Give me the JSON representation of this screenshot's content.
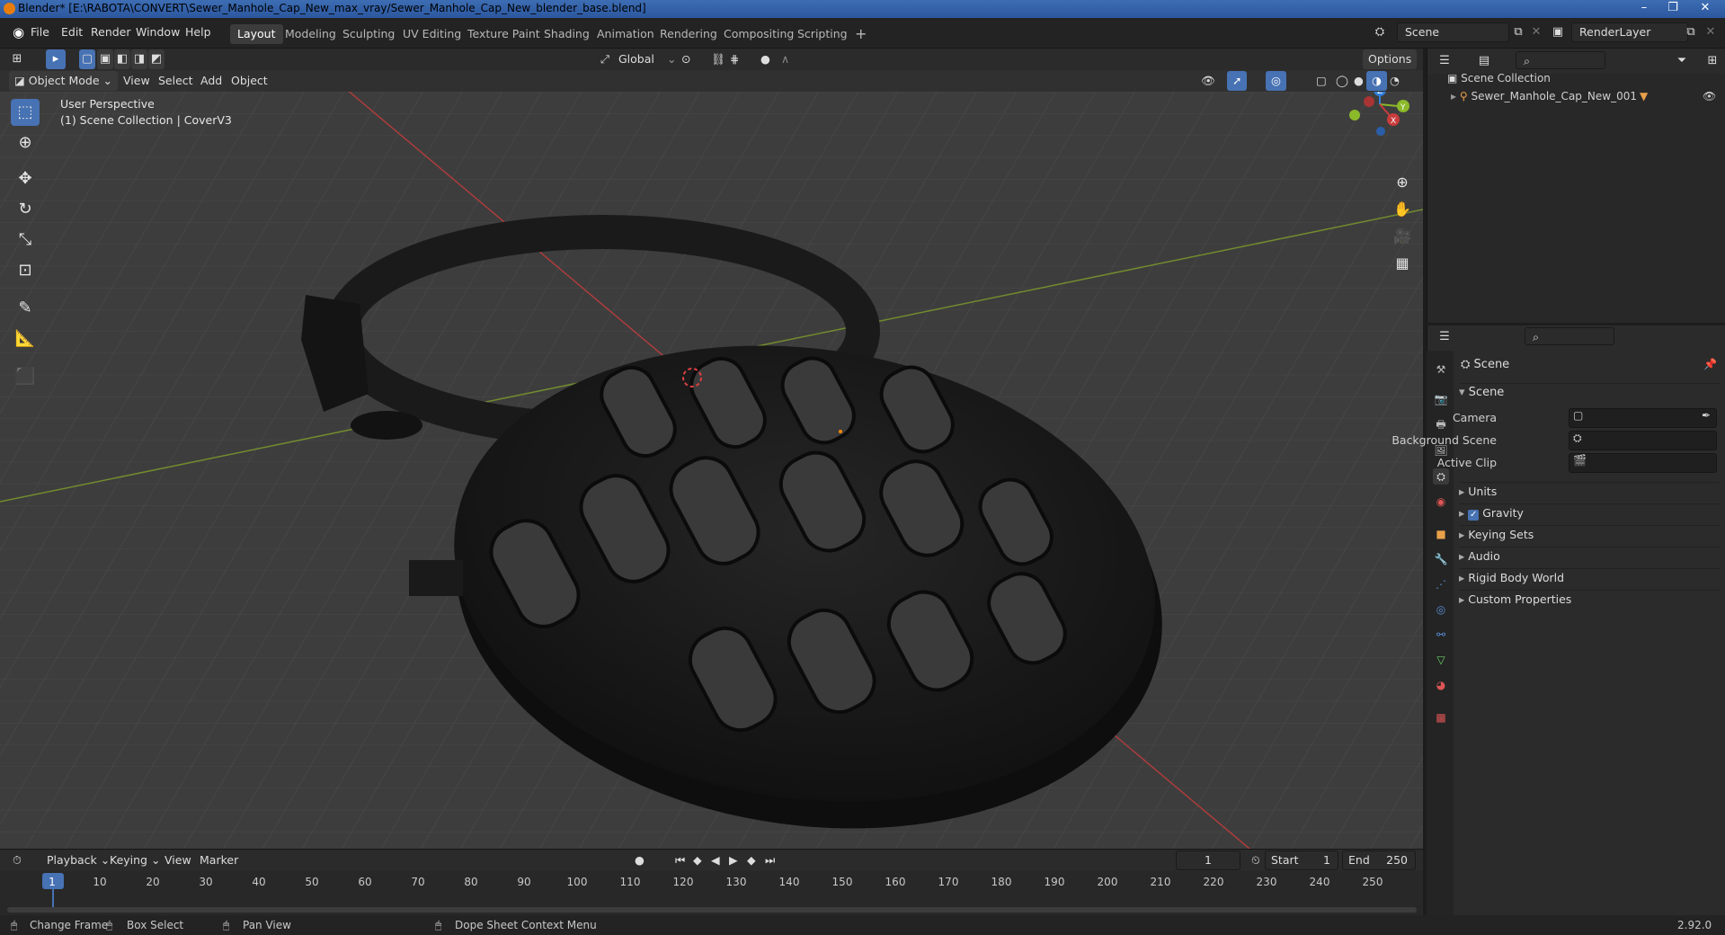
{
  "window": {
    "title": "Blender* [E:\\RABOTA\\CONVERT\\Sewer_Manhole_Cap_New_max_vray/Sewer_Manhole_Cap_New_blender_base.blend]",
    "controls": [
      "–",
      "❐",
      "✕"
    ]
  },
  "menu": [
    "File",
    "Edit",
    "Render",
    "Window",
    "Help"
  ],
  "workspaces": [
    "Layout",
    "Modeling",
    "Sculpting",
    "UV Editing",
    "Texture Paint",
    "Shading",
    "Animation",
    "Rendering",
    "Compositing",
    "Scripting"
  ],
  "active_workspace": "Layout",
  "scene_selector": "Scene",
  "render_layer": "RenderLayer",
  "viewport_header": {
    "mode": "Object Mode",
    "menus": [
      "View",
      "Select",
      "Add",
      "Object"
    ],
    "transform_orientation": "Global",
    "options": "Options"
  },
  "viewport": {
    "perspective": "User Perspective",
    "collection_info": "(1) Scene Collection | CoverV3",
    "gizmo_axes": [
      "Z",
      "Y",
      "X"
    ],
    "tools": [
      "select-box-icon",
      "cursor-icon",
      "move-icon",
      "rotate-icon",
      "scale-icon",
      "transform-icon",
      "annotate-icon",
      "measure-icon",
      "add-cube-icon"
    ]
  },
  "outliner": {
    "root": "Scene Collection",
    "items": [
      {
        "label": "Sewer_Manhole_Cap_New_001"
      }
    ]
  },
  "properties": {
    "context": "Scene",
    "section": "Scene",
    "fields": [
      {
        "label": "Camera",
        "value": ""
      },
      {
        "label": "Background Scene",
        "value": ""
      },
      {
        "label": "Active Clip",
        "value": ""
      }
    ],
    "panels": [
      "Units",
      "Gravity",
      "Keying Sets",
      "Audio",
      "Rigid Body World",
      "Custom Properties"
    ],
    "gravity_checked": true
  },
  "timeline": {
    "menus": [
      "Playback",
      "Keying",
      "View",
      "Marker"
    ],
    "current_frame": "1",
    "start_label": "Start",
    "start": "1",
    "end_label": "End",
    "end": "250",
    "ticks": [
      "1",
      "10",
      "20",
      "30",
      "40",
      "50",
      "60",
      "70",
      "80",
      "90",
      "100",
      "110",
      "120",
      "130",
      "140",
      "150",
      "160",
      "170",
      "180",
      "190",
      "200",
      "210",
      "220",
      "230",
      "240",
      "250"
    ]
  },
  "statusbar": {
    "items": [
      "Change Frame",
      "Box Select",
      "Pan View",
      "Dope Sheet Context Menu"
    ],
    "version": "2.92.0"
  },
  "colors": {
    "accent": "#4772b3",
    "x_axis": "#c93c3c",
    "y_axis": "#8bb92a",
    "z_axis": "#2f7fdd"
  }
}
